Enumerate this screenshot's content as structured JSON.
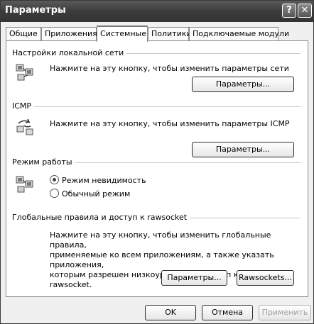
{
  "window": {
    "title": "Параметры",
    "help_label": "?",
    "close_label": "✕"
  },
  "tabs": [
    {
      "label": "Общие"
    },
    {
      "label": "Приложения"
    },
    {
      "label": "Системные",
      "active": true
    },
    {
      "label": "Политики"
    },
    {
      "label": "Подключаемые модули"
    }
  ],
  "sections": {
    "network": {
      "title": "Настройки локальной сети",
      "description": "Нажмите на эту кнопку, чтобы изменить параметры сети",
      "button": "Параметры...",
      "icon": "network-computers-icon"
    },
    "icmp": {
      "title": "ICMP",
      "description": "Нажмите на эту кнопку, чтобы изменить параметры ICMP",
      "button": "Параметры...",
      "icon": "icmp-arrows-icon"
    },
    "mode": {
      "title": "Режим работы",
      "icon": "mode-computers-icon",
      "options": [
        {
          "label": "Режим невидимость",
          "selected": true
        },
        {
          "label": "Обычный режим",
          "selected": false
        }
      ]
    },
    "rawsocket": {
      "title": "Глобальные правила и доступ к rawsocket",
      "description_lines": [
        "Нажмите на эту кнопку, чтобы изменить глобальные правила,",
        "применяемые ко всем приложениям, а также указать приложения,",
        "которым разрешен низкоуровневый доступ к сети через rawsocket."
      ],
      "button_params": "Параметры...",
      "button_rawsockets": "Rawsockets..."
    }
  },
  "footer": {
    "ok": "OK",
    "cancel": "Отмена",
    "apply": "Применить"
  }
}
